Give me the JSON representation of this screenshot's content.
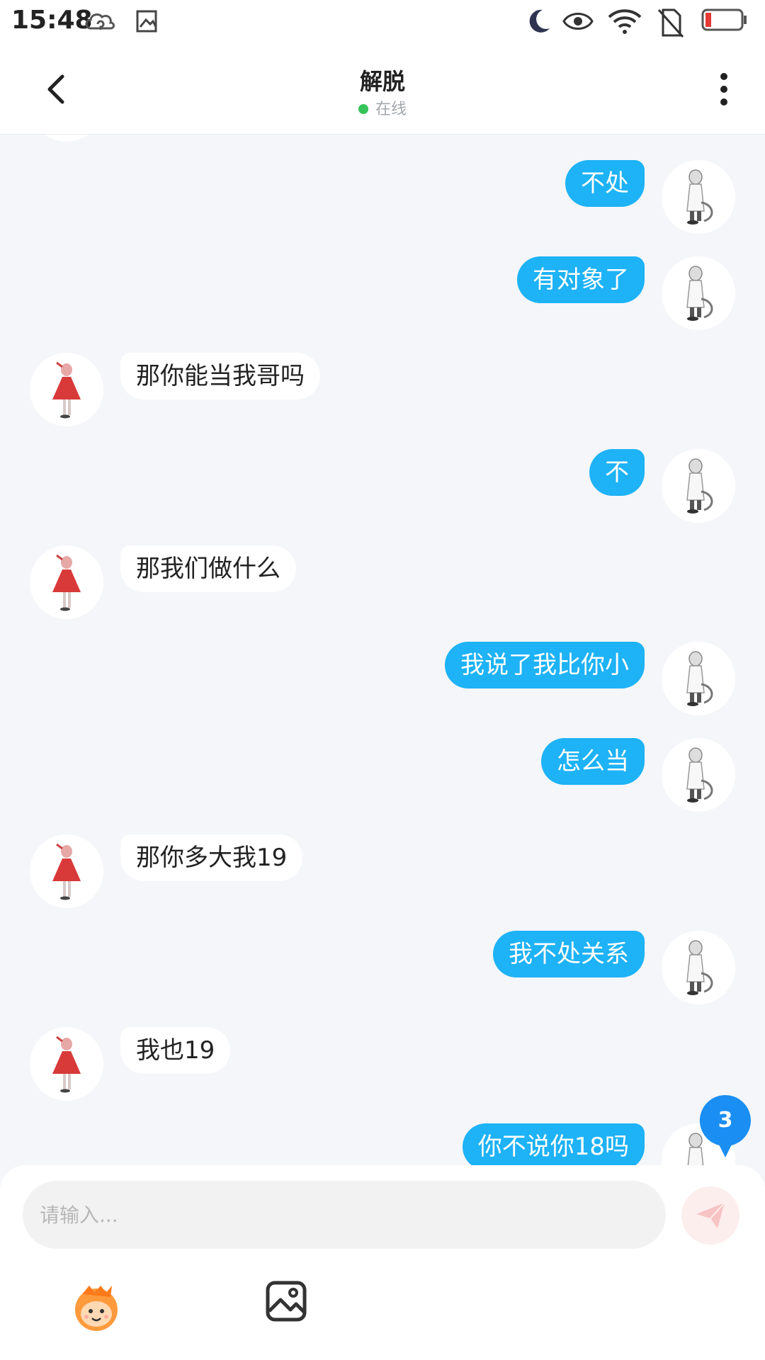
{
  "status_bar": {
    "time": "15:48"
  },
  "header": {
    "title": "解脱",
    "status": "在线"
  },
  "messages": [
    {
      "from": "me",
      "text": "不处"
    },
    {
      "from": "me",
      "text": "有对象了"
    },
    {
      "from": "them",
      "text": "那你能当我哥吗"
    },
    {
      "from": "me",
      "text": "不"
    },
    {
      "from": "them",
      "text": "那我们做什么"
    },
    {
      "from": "me",
      "text": "我说了我比你小"
    },
    {
      "from": "me",
      "text": "怎么当"
    },
    {
      "from": "them",
      "text": "那你多大我19"
    },
    {
      "from": "me",
      "text": "我不处关系"
    },
    {
      "from": "them",
      "text": "我也19"
    },
    {
      "from": "me",
      "text": "你不说你18吗"
    }
  ],
  "unread_badge": "3",
  "composer": {
    "placeholder": "请输入..."
  },
  "colors": {
    "my_bubble": "#1eb2f6",
    "their_bubble": "#ffffff",
    "background": "#f4f6f9",
    "online": "#36c35a",
    "send_button": "#fdeeee"
  },
  "icons": [
    "back-arrow-icon",
    "more-vert-icon",
    "send-icon",
    "emoji-icon",
    "image-icon",
    "moon-icon",
    "eye-icon",
    "wifi-icon",
    "battery-icon",
    "cloud-icon"
  ]
}
